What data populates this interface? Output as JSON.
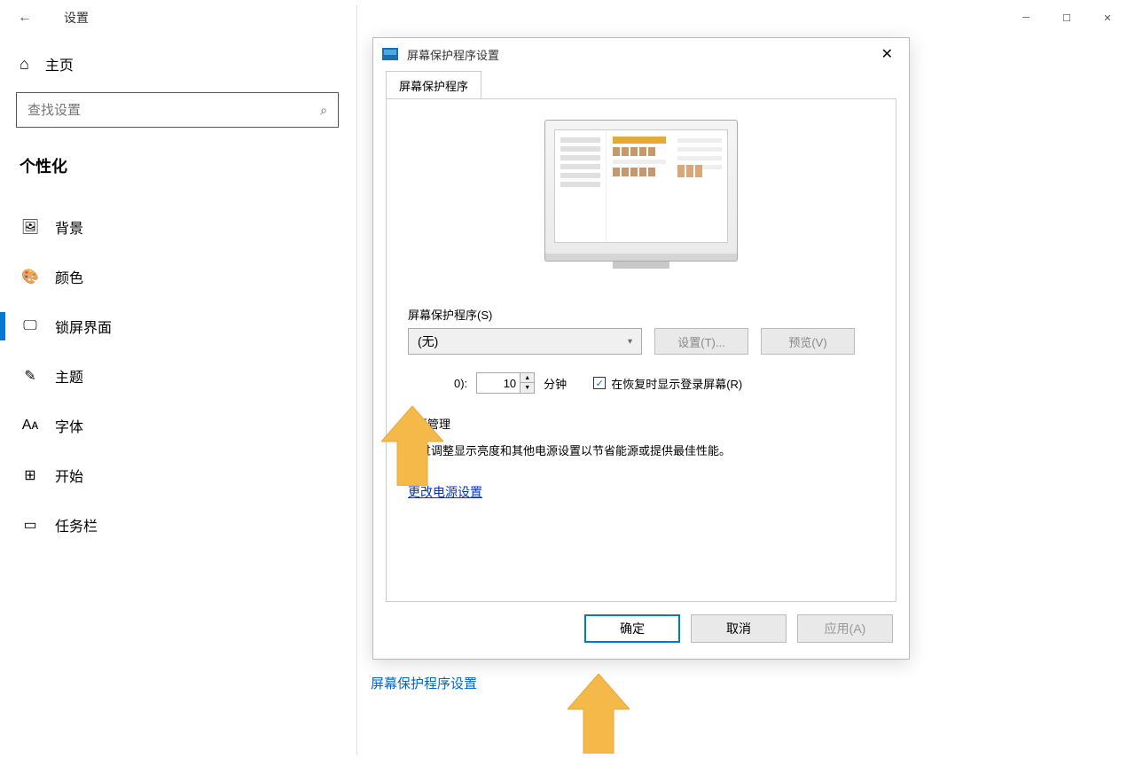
{
  "titlebar": {
    "back": "←",
    "title": "设置"
  },
  "sidebar": {
    "home": "主页",
    "search_placeholder": "查找设置",
    "section": "个性化",
    "items": [
      {
        "icon": "🖼",
        "label": "背景"
      },
      {
        "icon": "🎨",
        "label": "颜色"
      },
      {
        "icon": "🖵",
        "label": "锁屏界面"
      },
      {
        "icon": "✎",
        "label": "主题"
      },
      {
        "icon": "Aᴀ",
        "label": "字体"
      },
      {
        "icon": "⊞",
        "label": "开始"
      },
      {
        "icon": "▭",
        "label": "任务栏"
      }
    ]
  },
  "content": {
    "link_behind": "屏幕保护程序设置"
  },
  "dialog": {
    "title": "屏幕保护程序设置",
    "tab": "屏幕保护程序",
    "saver_label": "屏幕保护程序(S)",
    "saver_value": "(无)",
    "settings_btn": "设置(T)...",
    "preview_btn": "预览(V)",
    "wait_label": "0):",
    "wait_value": "10",
    "minutes": "分钟",
    "resume_label": "在恢复时显示登录屏幕(R)",
    "power_title": "电源管理",
    "power_desc": "通过调整显示亮度和其他电源设置以节省能源或提供最佳性能。",
    "power_link": "更改电源设置",
    "ok": "确定",
    "cancel": "取消",
    "apply": "应用(A)"
  }
}
